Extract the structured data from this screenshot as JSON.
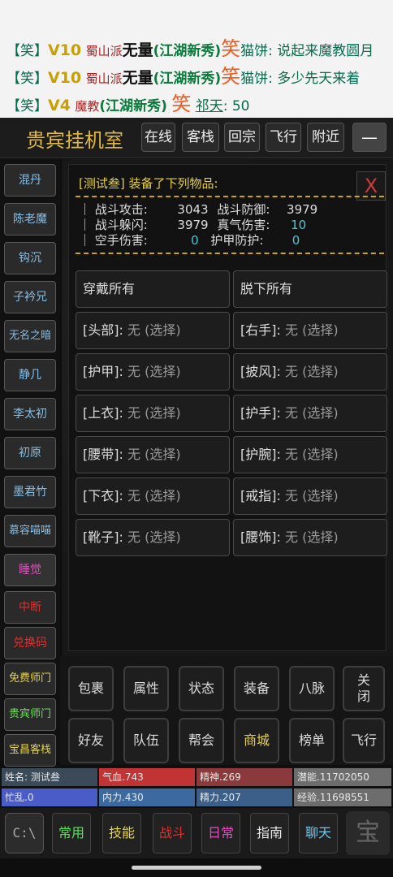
{
  "chat": [
    {
      "bracket": "【笑】",
      "vip": "V10",
      "sect": "",
      "name": "",
      "tag": "",
      "laugh": "笑",
      "who": "猫饼",
      "sep": ":",
      "msg": "说起来魔教圆月"
    },
    {
      "bracket": "【笑】",
      "vip": "V10",
      "sect": "蜀山派",
      "name": "无量",
      "tag": "(江湖新秀)",
      "laugh": "笑",
      "who": "猫饼",
      "sep": ":",
      "msg": "多少先天来着"
    },
    {
      "bracket": "【笑】",
      "vip": "V4",
      "sect": "魔教",
      "name": "",
      "tag": "(江湖新秀)",
      "laugh": "笑",
      "who": "祁天",
      "sep": ":",
      "msg": "50"
    }
  ],
  "header": {
    "title": "贵宾挂机室",
    "buttons": [
      "在线",
      "客栈",
      "回宗",
      "飞行",
      "附近"
    ],
    "collapse": "—"
  },
  "sidebar": [
    {
      "label": "混丹",
      "color": "blue"
    },
    {
      "label": "陈老魔",
      "color": "blue"
    },
    {
      "label": "钩沉",
      "color": "blue"
    },
    {
      "label": "子衿兄",
      "color": "blue"
    },
    {
      "label": "无名之暗",
      "color": "blue"
    },
    {
      "label": "静几",
      "color": "blue"
    },
    {
      "label": "李太初",
      "color": "blue"
    },
    {
      "label": "初原",
      "color": "blue"
    },
    {
      "label": "墨君竹",
      "color": "blue"
    },
    {
      "label": "慕容喵喵",
      "color": "blue"
    },
    {
      "label": "睡觉",
      "color": "pink"
    },
    {
      "label": "中断",
      "color": "red"
    },
    {
      "label": "兑换码",
      "color": "red"
    },
    {
      "label": "免费师门",
      "color": "yellow"
    },
    {
      "label": "贵宾师门",
      "color": "green"
    },
    {
      "label": "宝昌客栈",
      "color": "yellow"
    }
  ],
  "equip": {
    "title": "[测试叁] 装备了下列物品:",
    "close": "X",
    "stats": {
      "row1": {
        "l1": "｜ 战斗攻击:",
        "v1": "3043",
        "l2": "战斗防御:",
        "v2": "3979"
      },
      "row2": {
        "l1": "｜ 战斗躲闪:",
        "v1": "3979",
        "l2": "真气伤害:",
        "v2": "10"
      },
      "row3": {
        "l1": "｜ 空手伤害:",
        "v1": "0",
        "l2": "护甲防护:",
        "v2": "0"
      }
    },
    "wear_all": "穿戴所有",
    "remove_all": "脱下所有",
    "slots": [
      {
        "slot": "[头部]:",
        "value": "无 (选择)"
      },
      {
        "slot": "[右手]:",
        "value": "无 (选择)"
      },
      {
        "slot": "[护甲]:",
        "value": "无 (选择)"
      },
      {
        "slot": "[披风]:",
        "value": "无 (选择)"
      },
      {
        "slot": "[上衣]:",
        "value": "无 (选择)"
      },
      {
        "slot": "[护手]:",
        "value": "无 (选择)"
      },
      {
        "slot": "[腰带]:",
        "value": "无 (选择)"
      },
      {
        "slot": "[护腕]:",
        "value": "无 (选择)"
      },
      {
        "slot": "[下衣]:",
        "value": "无 (选择)"
      },
      {
        "slot": "[戒指]:",
        "value": "无 (选择)"
      },
      {
        "slot": "[靴子]:",
        "value": "无 (选择)"
      },
      {
        "slot": "[腰饰]:",
        "value": "无 (选择)"
      }
    ]
  },
  "menu": {
    "row1": [
      "包裹",
      "属性",
      "状态",
      "装备",
      "八脉",
      "关闭"
    ],
    "row2": [
      "好友",
      "队伍",
      "帮会",
      "商城",
      "榜单",
      "飞行"
    ]
  },
  "status": {
    "name": "姓名: 测试叁",
    "hp": "气血.743",
    "spirit": "精神.269",
    "potential": "潜能.11702050",
    "mood": "忙乱.0",
    "neili": "内力.430",
    "jingli": "精力.207",
    "exp": "经验.11698551"
  },
  "footer": {
    "cmd": "C:\\",
    "buttons": [
      "常用",
      "技能",
      "战斗",
      "日常",
      "指南",
      "聊天"
    ],
    "seal": "宝"
  },
  "colors": {
    "gold": "#e5cf3b",
    "stat_cyan": "#49c7d8",
    "hp_red": "#d03a3a",
    "mood_blue": "#4a5cc8",
    "potential_gray": "#777"
  }
}
